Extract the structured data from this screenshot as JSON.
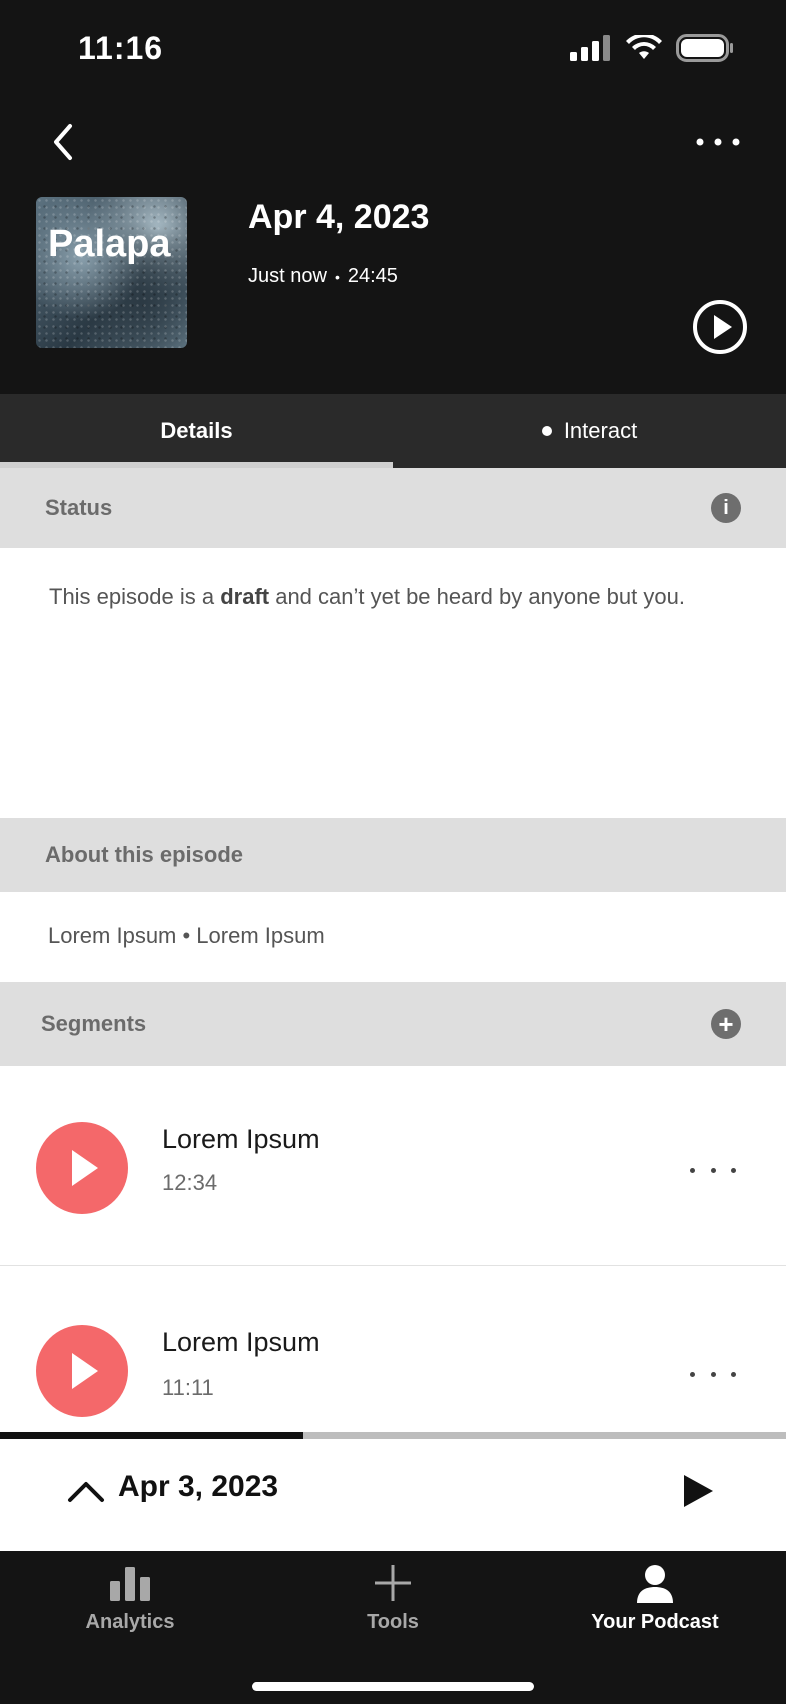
{
  "status_bar": {
    "time": "11:16"
  },
  "header": {
    "cover_title": "Palapa",
    "episode_title": "Apr 4, 2023",
    "meta_time": "Just now",
    "meta_dot": "•",
    "meta_duration": "24:45"
  },
  "tabs": [
    {
      "label": "Details",
      "active": true
    },
    {
      "label": "Interact",
      "active": false
    }
  ],
  "status_section": {
    "heading": "Status",
    "text_before": "This episode is a ",
    "text_bold": "draft",
    "text_after": " and can’t yet be heard by anyone but you."
  },
  "about_section": {
    "heading": "About this episode",
    "text": "Lorem Ipsum • Lorem Ipsum"
  },
  "segments_section": {
    "heading": "Segments",
    "items": [
      {
        "title": "Lorem Ipsum",
        "duration": "12:34"
      },
      {
        "title": "Lorem Ipsum",
        "duration": "11:11"
      }
    ]
  },
  "mini_player": {
    "title": "Apr 3, 2023",
    "progress": 0.385
  },
  "bottom_nav": [
    {
      "label": "Analytics",
      "icon": "bar-chart-icon",
      "active": false
    },
    {
      "label": "Tools",
      "icon": "plus-icon",
      "active": false
    },
    {
      "label": "Your Podcast",
      "icon": "person-icon",
      "active": true
    }
  ],
  "colors": {
    "accent": "#f4686a",
    "header_bg": "#141414",
    "section_bg": "#dedede"
  }
}
